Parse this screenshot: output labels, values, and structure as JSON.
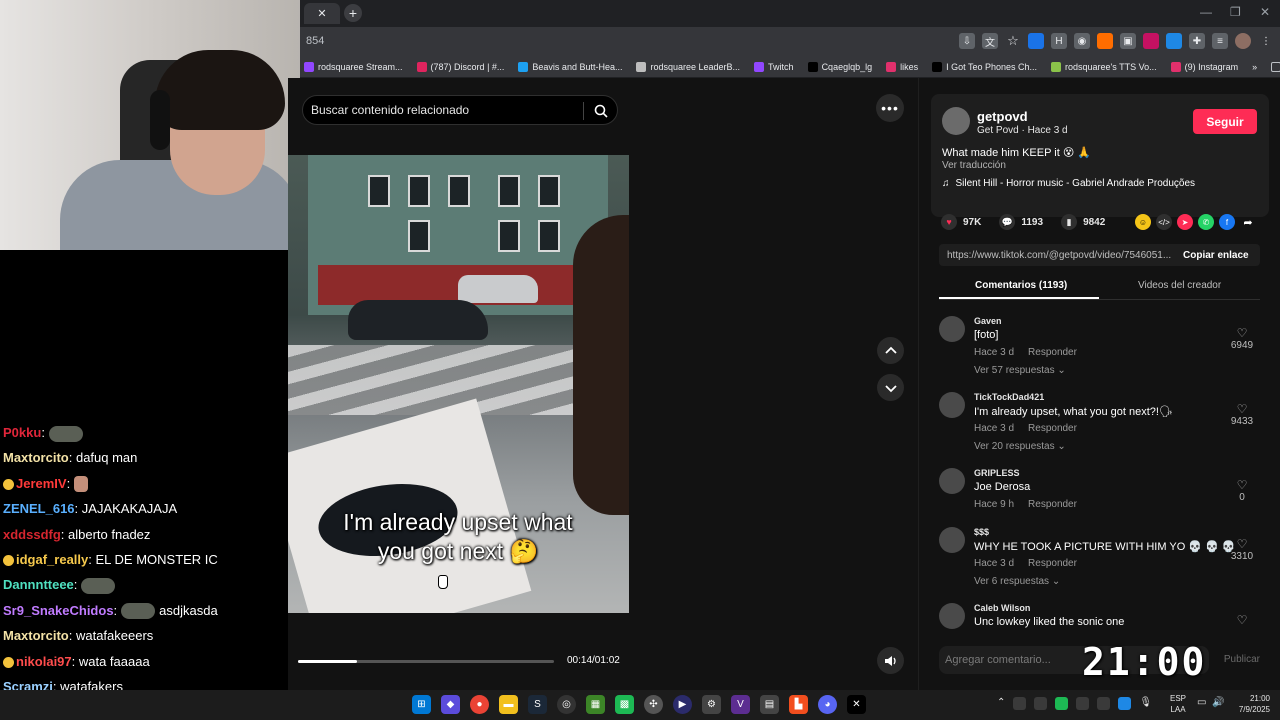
{
  "browser": {
    "tab_close": "✕",
    "new_tab": "+",
    "address_text": "854",
    "bookmarks": [
      {
        "label": "rodsquaree Stream...",
        "color": "#9147ff"
      },
      {
        "label": "(787) Discord | #...",
        "color": "#e0245e"
      },
      {
        "label": "Beavis and Butt-Hea...",
        "color": "#1da1f2"
      },
      {
        "label": "rodsquaree LeaderB...",
        "color": "#bdbdbd"
      },
      {
        "label": "Twitch",
        "color": "#9147ff"
      },
      {
        "label": "Cqaeglqb_lg",
        "color": "#000000"
      },
      {
        "label": "likes",
        "color": "#e1306c"
      },
      {
        "label": "I Got Teo Phones Ch...",
        "color": "#000000"
      },
      {
        "label": "rodsquaree's TTS Vo...",
        "color": "#8bc34a"
      },
      {
        "label": "(9) Instagram",
        "color": "#e1306c"
      }
    ],
    "bookmarks_more": "»",
    "all_bookmarks": "Todos los marcadores"
  },
  "search": {
    "placeholder": "Buscar contenido relacionado"
  },
  "video": {
    "caption_line1": "I'm already upset what",
    "caption_line2": "you got next 🤔",
    "time": "00:14/01:02",
    "progress": 0.23
  },
  "creator": {
    "username": "getpovd",
    "subtitle": "Get Povd · Hace 3 d",
    "follow_label": "Seguir",
    "description": "What made him KEEP it 😵 🙏",
    "translate_label": "Ver traducción",
    "music": "Silent Hill - Horror music - Gabriel Andrade Produções"
  },
  "stats": {
    "likes": "97K",
    "comments": "1193",
    "saves": "9842"
  },
  "link": {
    "url": "https://www.tiktok.com/@getpovd/video/7546051...",
    "copy_label": "Copiar enlace"
  },
  "tabs": {
    "comments": "Comentarios (1193)",
    "creator_videos": "Videos del creador"
  },
  "comments": [
    {
      "user": "Gaven",
      "text": "[foto]",
      "time": "Hace 3 d",
      "reply": "Responder",
      "replies": "Ver 57 respuestas ⌄",
      "likes": "6949"
    },
    {
      "user": "TickTockDad421",
      "text": "I'm already upset, what you got next?!🗣",
      "time": "Hace 3 d",
      "reply": "Responder",
      "replies": "Ver 20 respuestas ⌄",
      "likes": "9433"
    },
    {
      "user": "GRIPLESS",
      "text": "Joe Derosa",
      "time": "Hace 9 h",
      "reply": "Responder",
      "replies": "",
      "likes": "0"
    },
    {
      "user": "$$$",
      "text": "WHY HE TOOK A PICTURE WITH HIM YO 💀 💀 💀",
      "time": "Hace 3 d",
      "reply": "Responder",
      "replies": "Ver 6 respuestas ⌄",
      "likes": "3310"
    },
    {
      "user": "Caleb Wilson",
      "text": "Unc lowkey liked the sonic one",
      "time": "",
      "reply": "",
      "replies": "",
      "likes": ""
    }
  ],
  "add_comment": {
    "placeholder": "Agregar comentario...",
    "publish": "Publicar"
  },
  "overlay_clock": "21:00",
  "chat": [
    {
      "user": "P0kku",
      "color": "#e0263a",
      "text": ":",
      "emote": "big"
    },
    {
      "user": "Maxtorcito",
      "color": "#f2e1a6",
      "text": ": dafuq man",
      "emote": ""
    },
    {
      "user": "JeremIV",
      "color": "#ff3a3a",
      "text": ":",
      "emote": "small",
      "badge": true
    },
    {
      "user": "ZENEL_616",
      "color": "#5ab0ff",
      "text": ": JAJAKAKAJAJA",
      "emote": ""
    },
    {
      "user": "xddssdfg",
      "color": "#d6262f",
      "text": ": alberto fnadez",
      "emote": ""
    },
    {
      "user": "idgaf_really",
      "color": "#f6c94c",
      "text": ": EL DE MONSTER IC",
      "emote": "",
      "badge": true
    },
    {
      "user": "Dannntteee",
      "color": "#4fe0c0",
      "text": ":",
      "emote": "big"
    },
    {
      "user": "Sr9_SnakeChidos",
      "color": "#c07bff",
      "text": ": asdjkasda",
      "emote": "big-mid"
    },
    {
      "user": "Maxtorcito",
      "color": "#f2e1a6",
      "text": ": watafakeeers",
      "emote": ""
    },
    {
      "user": "nikolai97",
      "color": "#ff4d4d",
      "text": ": wata faaaaa",
      "emote": "",
      "badge": true
    },
    {
      "user": "Scramzi",
      "color": "#9ad0ff",
      "text": ": watafakers",
      "emote": ""
    },
    {
      "user": "ZENEL_616",
      "color": "#5ab0ff",
      "text": ": WTFFFFFFFFFF",
      "emote": ""
    }
  ],
  "taskbar": {
    "lang_line1": "ESP",
    "lang_line2": "LAA",
    "time": "21:00",
    "date": "7/9/2025"
  }
}
